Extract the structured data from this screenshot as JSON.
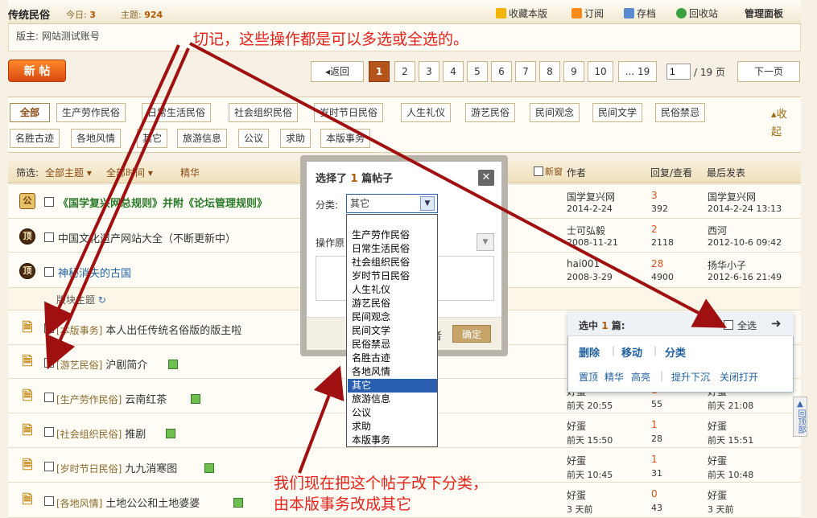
{
  "header": {
    "forum_title": "传统民俗",
    "today_label": "今日:",
    "today_count": "3",
    "threads_label": "主题:",
    "threads_count": "924",
    "actions": [
      "收藏本版",
      "订阅",
      "存档",
      "回收站",
      "管理面板"
    ],
    "moderator": "版主: 网站测试账号"
  },
  "toolbar": {
    "new_post_label": "新 帖",
    "back_label": "返回",
    "pages": [
      "1",
      "2",
      "3",
      "4",
      "5",
      "6",
      "7",
      "8",
      "9",
      "10"
    ],
    "ellipsis_last": "... 19",
    "page_input": "1",
    "page_total": "/ 19 页",
    "next_label": "下一页"
  },
  "categories": [
    "全部",
    "生产劳作民俗",
    "日常生活民俗",
    "社会组织民俗",
    "岁时节日民俗",
    "人生礼仪",
    "游艺民俗",
    "民间观念",
    "民间文学",
    "民俗禁忌",
    "名胜古迹",
    "各地风情",
    "其它",
    "旅游信息",
    "公议",
    "求助",
    "本版事务"
  ],
  "collapse_label": "收起",
  "list_header": {
    "filter_label": "筛选:",
    "all_topics": "全部主题",
    "all_time": "全部时间",
    "digest": "精华",
    "new_window": "新窗",
    "author": "作者",
    "replies_views": "回复/查看",
    "last_post": "最后发表"
  },
  "sticky_rows": [
    {
      "badge": "公",
      "title": "《国学复兴网总规则》并附《论坛管理规则》",
      "author": "国学复兴网",
      "date": "2014-2-24",
      "replies": "3",
      "views": "392",
      "last_author": "国学复兴网",
      "last_date": "2014-2-24 13:13"
    },
    {
      "badge": "顶",
      "title": "中国文化遗产网站大全（不断更新中）",
      "author": "士可弘毅",
      "date": "2008-11-21",
      "replies": "2",
      "views": "2118",
      "last_author": "西河",
      "last_date": "2012-10-6 09:42"
    },
    {
      "badge": "顶",
      "title": "神秘消失的古国",
      "author": "hai001",
      "date": "2008-3-29",
      "replies": "28",
      "views": "4900",
      "last_author": "扬华小子",
      "last_date": "2012-6-16 21:49"
    }
  ],
  "board_topics_label": "版块主题",
  "normal_rows": [
    {
      "tag": "[本版事务]",
      "title": "本人出任传统名俗版的版主啦",
      "checked": true,
      "author": "",
      "date": "",
      "replies": "",
      "views": "",
      "last_author": "",
      "last_date": ""
    },
    {
      "tag": "[游艺民俗]",
      "title": "沪剧简介",
      "checked": false,
      "author": "",
      "date": "",
      "replies": "",
      "views": "",
      "last_author": "",
      "last_date": ""
    },
    {
      "tag": "[生产劳作民俗]",
      "title": "云南红茶",
      "checked": false,
      "author": "好蛋",
      "date": "前天 20:55",
      "replies": "1",
      "views": "55",
      "last_author": "好蛋",
      "last_date": "前天 21:08"
    },
    {
      "tag": "[社会组织民俗]",
      "title": "推剧",
      "checked": false,
      "author": "好蛋",
      "date": "前天 15:50",
      "replies": "1",
      "views": "28",
      "last_author": "好蛋",
      "last_date": "前天 15:51"
    },
    {
      "tag": "[岁时节日民俗]",
      "title": "九九消寒图",
      "checked": false,
      "author": "好蛋",
      "date": "前天 10:45",
      "replies": "1",
      "views": "31",
      "last_author": "好蛋",
      "last_date": "前天 10:48"
    },
    {
      "tag": "[各地风情]",
      "title": "土地公公和土地婆婆",
      "checked": false,
      "author": "好蛋",
      "date": "3 天前",
      "replies": "0",
      "views": "43",
      "last_author": "好蛋",
      "last_date": "3 天前"
    }
  ],
  "dialog": {
    "title_pre": "选择了",
    "count": "1",
    "title_post": "篇帖子",
    "category_label": "分类:",
    "category_value": "其它",
    "reason_label": "操作原",
    "notify_label": "者",
    "confirm_label": "确定",
    "options": [
      "生产劳作民俗",
      "日常生活民俗",
      "社会组织民俗",
      "岁时节日民俗",
      "人生礼仪",
      "游艺民俗",
      "民间观念",
      "民间文学",
      "民俗禁忌",
      "名胜古迹",
      "各地风情",
      "其它",
      "旅游信息",
      "公议",
      "求助",
      "本版事务"
    ],
    "selected_option": "其它"
  },
  "selection_popup": {
    "title_pre": "选中",
    "count": "1",
    "title_post": "篇:",
    "select_all": "全选",
    "actions_main": [
      "删除",
      "移动",
      "分类"
    ],
    "actions_sub": [
      "置顶",
      "精华",
      "高亮",
      "提升下沉",
      "关闭打开"
    ]
  },
  "back_to_top": "回顶部",
  "annotations": {
    "top_note": "切记，这些操作都是可以多选或全选的。",
    "bottom_note_1": "我们现在把这个帖子改下分类，",
    "bottom_note_2": "由本版事务改成其它"
  },
  "colors": {
    "accent": "#b4541b",
    "annotation": "#e5231b",
    "link": "#1f5fa0",
    "arrow": "#a01010"
  }
}
